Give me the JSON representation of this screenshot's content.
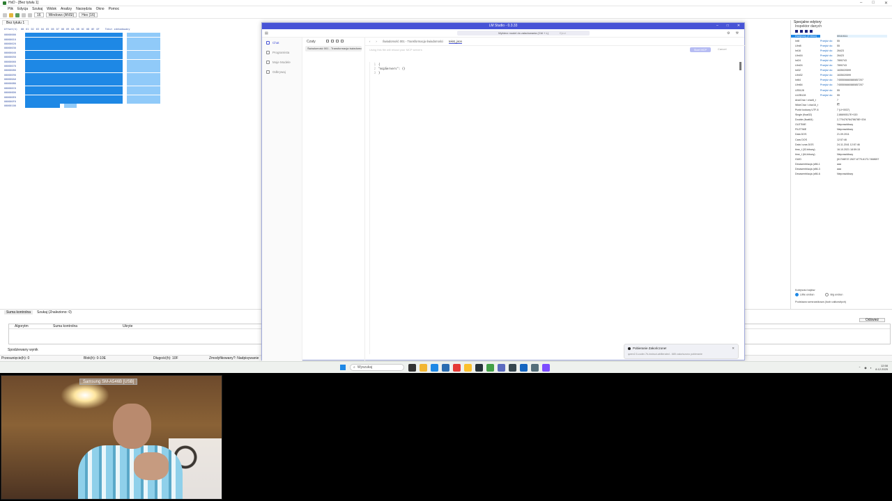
{
  "hxd": {
    "window_title": "HxD - [Bez tytułu 1]",
    "menu": [
      "Plik",
      "Edycja",
      "Szukaj",
      "Widok",
      "Analizy",
      "Narzędzia",
      "Okno",
      "Pomoc"
    ],
    "toolbar": {
      "columns": "16",
      "encoding": "Windows (ANSI)",
      "base": "Hex (16)"
    },
    "doc_tab": "Bez tytułu 1",
    "hex_header": {
      "offset_label": "Offset(h)",
      "columns": [
        "00",
        "01",
        "02",
        "03",
        "04",
        "05",
        "06",
        "07",
        "08",
        "09",
        "0A",
        "0B",
        "0C",
        "0D",
        "0E",
        "0F"
      ],
      "text_label": "Tekst zdekodowany"
    },
    "offsets": [
      "00000000",
      "00000010",
      "00000020",
      "00000030",
      "00000040",
      "00000050",
      "00000060",
      "00000070",
      "00000080",
      "00000090",
      "000000A0",
      "000000B0",
      "000000C0",
      "000000D0",
      "000000E0",
      "000000F0",
      "00000100"
    ],
    "inspector": {
      "title": "Specjalne edytory",
      "subtitle": "Inspektor danych",
      "rows": [
        {
          "type": "Dwójkowy (8 bitów)",
          "link": "",
          "value": "00110111"
        },
        {
          "type": "Int8",
          "link": "Przejdź do:",
          "value": "55"
        },
        {
          "type": "UInt8",
          "link": "Przejdź do:",
          "value": "55"
        },
        {
          "type": "Int16",
          "link": "Przejdź do:",
          "value": "26423"
        },
        {
          "type": "UInt16",
          "link": "Przejdź do:",
          "value": "26423"
        },
        {
          "type": "Int24",
          "link": "Przejdź do:",
          "value": "7890743"
        },
        {
          "type": "UInt24",
          "link": "Przejdź do:",
          "value": "7890743"
        },
        {
          "type": "Int32",
          "link": "Przejdź do:",
          "value": "1635020599"
        },
        {
          "type": "UInt32",
          "link": "Przejdź do:",
          "value": "1635020599"
        },
        {
          "type": "Int64",
          "link": "Przejdź do:",
          "value": "7455506660880857207"
        },
        {
          "type": "UInt64",
          "link": "Przejdź do:",
          "value": "7455506660880857207"
        },
        {
          "type": "LEB128",
          "link": "Przejdź do:",
          "value": "55"
        },
        {
          "type": "ULEB128",
          "link": "Przejdź do:",
          "value": "55"
        },
        {
          "type": "AnsiChar / char8_t",
          "link": "",
          "value": "7"
        },
        {
          "type": "WideChar / char16_t",
          "link": "",
          "value": "杷"
        },
        {
          "type": "Punkt kodowy UTF-8",
          "link": "",
          "value": "7 (U+0037)"
        },
        {
          "type": "Single (float32)",
          "link": "",
          "value": "2,86690517E+020"
        },
        {
          "type": "Double (float64)",
          "link": "",
          "value": "2,77047678478678E+204"
        },
        {
          "type": "OLETIME",
          "link": "",
          "value": "Nieprawidłowy"
        },
        {
          "type": "FILETIME",
          "link": "",
          "value": "Nieprawidłowy"
        },
        {
          "type": "Data DOS",
          "link": "",
          "value": "21.09.2011"
        },
        {
          "type": "Czas DOS",
          "link": "",
          "value": "12:57:46"
        },
        {
          "type": "Data i czas DOS",
          "link": "",
          "value": "24.11.2041 12:57:46"
        },
        {
          "type": "time_t (32-bitowy)",
          "link": "",
          "value": "16.10.2021 18:59:15"
        },
        {
          "type": "time_t (64-bitowy)",
          "link": "",
          "value": "Nieprawidłowy"
        },
        {
          "type": "GUID",
          "link": "",
          "value": "{61746E37-2627-6770-6173-7468657"
        },
        {
          "type": "Dezasemblacja (x86-16)",
          "link": "",
          "value": "aaa"
        },
        {
          "type": "Dezasemblacja (x86-32)",
          "link": "",
          "value": "aaa"
        },
        {
          "type": "Dezasemblacja (x86-64)",
          "link": "",
          "value": "Nieprawidłowy"
        }
      ],
      "byte_order_label": "Kolejność bajtów",
      "little_endian": "Little endian",
      "big_endian": "Big endian",
      "hex_check": "Podstawa szesnastkowa (liczb całkowitych)"
    },
    "results": {
      "tabs": [
        "Suma kontrolna",
        "Szukaj (Znaleziono: 0)"
      ],
      "columns": [
        "Algorytm",
        "Suma kontrolna",
        "Ukryte"
      ],
      "footer": "Spodziewany wynik",
      "button": "Odśwież"
    },
    "statusbar": [
      "Przesunięcie(h): 0",
      "Blok(h): 0-10E",
      "Długość(h): 10F",
      "Zmodyfikowany?: Nadpisywanie"
    ]
  },
  "lmstudio": {
    "title": "LM Studio - 0.3.33",
    "model_selector": "Wybierz model do załadowania (Ctrl + L)",
    "eject": "Eject",
    "sidebar": [
      "Chat",
      "Programista",
      "Moje Modele",
      "Odkrywaj"
    ],
    "list_header": "Czaty",
    "conversation": "Świadomość 001 - Transformacja świadomości",
    "tabs": [
      "Świadomość 001 - Transformacja świadomości",
      "tekst_json"
    ],
    "system_prompt_placeholder": "Using this file will reload your MCP servers",
    "start_button": "Start MCP",
    "cancel_button": "Cancel",
    "editor_lines": [
      {
        "n": "1",
        "code": "{"
      },
      {
        "n": "2",
        "code": "  \"mcpServers\": {}"
      },
      {
        "n": "3",
        "code": "}"
      }
    ]
  },
  "toast": {
    "title": "Pobieranie Zakończone!",
    "body": "qwen2.5-coder-7b-instruct-abliterated - 685 zakończono pobieranie"
  },
  "taskbar": {
    "search_placeholder": "Wyszukaj",
    "time": "12:58",
    "date": "8.12.2025"
  },
  "webcam": {
    "label": "Samsung SM-A546B [USB]"
  },
  "colors": {
    "lm_accent": "#4753d6",
    "hex_selection": "#1e88e5",
    "text_selection": "#90caf9"
  }
}
